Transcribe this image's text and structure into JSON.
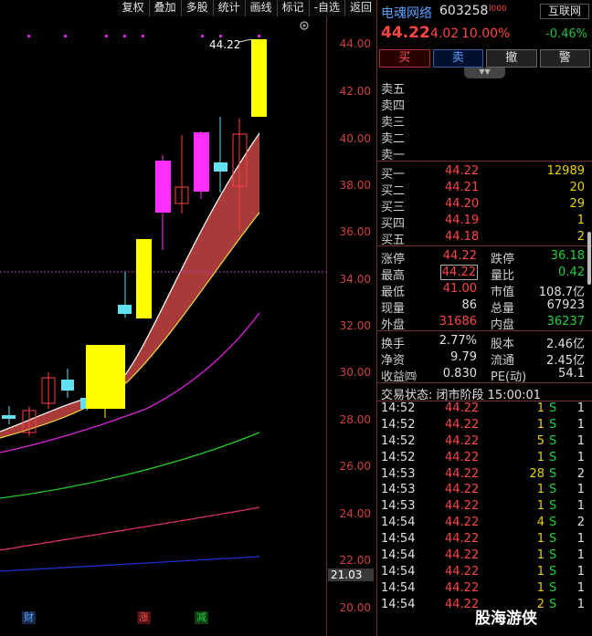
{
  "toolbar": {
    "items": [
      "复权",
      "叠加",
      "多股",
      "统计",
      "画线",
      "标记",
      "-自选",
      "返回"
    ]
  },
  "chart": {
    "y_labels": [
      "44.00",
      "42.00",
      "40.00",
      "38.00",
      "36.00",
      "34.00",
      "32.00",
      "30.00",
      "28.00",
      "26.00",
      "24.00",
      "22.00",
      "20.00"
    ],
    "high_label": "44.22",
    "current_price_label": "21.03",
    "markers": [
      {
        "text": "财",
        "color": "#5aa0ff",
        "bg": "#1a2a4a"
      },
      {
        "text": "涨",
        "color": "#ff5050",
        "bg": "#4a1010"
      },
      {
        "text": "减",
        "color": "#20d040",
        "bg": "#103a10"
      }
    ]
  },
  "header": {
    "stock_name": "电魂网络",
    "stock_code": "603258",
    "level_tag": "l000",
    "sector_button": "互联网",
    "last_price": "44.22",
    "change": "4.02",
    "change_pct": "10.00%",
    "sector_pct": "-0.46%"
  },
  "trade_buttons": {
    "buy": "买",
    "sell": "卖",
    "cancel": "撤",
    "alert": "警"
  },
  "order_book": {
    "sell": [
      {
        "label": "卖五",
        "price": "",
        "vol": ""
      },
      {
        "label": "卖四",
        "price": "",
        "vol": ""
      },
      {
        "label": "卖三",
        "price": "",
        "vol": ""
      },
      {
        "label": "卖二",
        "price": "",
        "vol": ""
      },
      {
        "label": "卖一",
        "price": "",
        "vol": ""
      }
    ],
    "buy": [
      {
        "label": "买一",
        "price": "44.22",
        "vol": "12989"
      },
      {
        "label": "买二",
        "price": "44.21",
        "vol": "20"
      },
      {
        "label": "买三",
        "price": "44.20",
        "vol": "29"
      },
      {
        "label": "买四",
        "price": "44.19",
        "vol": "1"
      },
      {
        "label": "买五",
        "price": "44.18",
        "vol": "2"
      }
    ]
  },
  "stats": {
    "zhangting_label": "涨停",
    "zhangting": "44.22",
    "dieting_label": "跌停",
    "dieting": "36.18",
    "zuigao_label": "最高",
    "zuigao": "44.22",
    "liangbi_label": "量比",
    "liangbi": "0.42",
    "zuidi_label": "最低",
    "zuidi": "41.00",
    "shizhi_label": "市值",
    "shizhi": "108.7亿",
    "xianliang_label": "现量",
    "xianliang": "86",
    "zongliang_label": "总量",
    "zongliang": "67923",
    "waipan_label": "外盘",
    "waipan": "31686",
    "neipan_label": "内盘",
    "neipan": "36237"
  },
  "stats2": {
    "huanshou_label": "换手",
    "huanshou": "2.77%",
    "guben_label": "股本",
    "guben": "2.46亿",
    "jingzi_label": "净资",
    "jingzi": "9.79",
    "liutong_label": "流通",
    "liutong": "2.45亿",
    "shouyi_label": "收益㈣",
    "shouyi": "0.830",
    "pe_label": "PE(动)",
    "pe": "54.1"
  },
  "status": "交易状态: 闭市阶段 15:00:01",
  "ticks": [
    {
      "time": "14:52",
      "price": "44.22",
      "vol": "1",
      "side": "S",
      "num": "1"
    },
    {
      "time": "14:52",
      "price": "44.22",
      "vol": "1",
      "side": "S",
      "num": "1"
    },
    {
      "time": "14:52",
      "price": "44.22",
      "vol": "5",
      "side": "S",
      "num": "1"
    },
    {
      "time": "14:52",
      "price": "44.22",
      "vol": "1",
      "side": "S",
      "num": "1"
    },
    {
      "time": "14:53",
      "price": "44.22",
      "vol": "28",
      "side": "S",
      "num": "2"
    },
    {
      "time": "14:53",
      "price": "44.22",
      "vol": "1",
      "side": "S",
      "num": "1"
    },
    {
      "time": "14:53",
      "price": "44.22",
      "vol": "1",
      "side": "S",
      "num": "1"
    },
    {
      "time": "14:54",
      "price": "44.22",
      "vol": "4",
      "side": "S",
      "num": "2"
    },
    {
      "time": "14:54",
      "price": "44.22",
      "vol": "1",
      "side": "S",
      "num": "1"
    },
    {
      "time": "14:54",
      "price": "44.22",
      "vol": "1",
      "side": "S",
      "num": "1"
    },
    {
      "time": "14:54",
      "price": "44.22",
      "vol": "1",
      "side": "S",
      "num": "1"
    },
    {
      "time": "14:54",
      "price": "44.22",
      "vol": "1",
      "side": "S",
      "num": "1"
    },
    {
      "time": "14:54",
      "price": "44.22",
      "vol": "2",
      "side": "S",
      "num": "1"
    }
  ],
  "watermark": "股海游侠",
  "colors": {
    "up": "#ff4545",
    "down": "#20d040",
    "accent": "#5aa0ff"
  }
}
